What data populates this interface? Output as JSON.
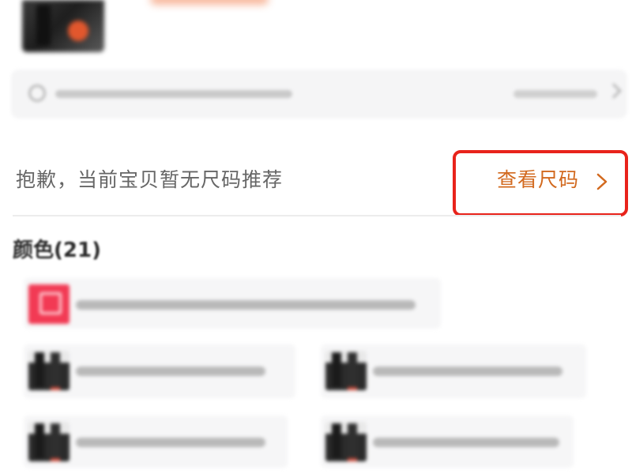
{
  "size_recommendation": {
    "message": "抱歉，当前宝贝暂无尺码推荐",
    "view_size_label": "查看尺码",
    "highlight_color": "#e8231b",
    "link_color": "#d2691e"
  },
  "colors": {
    "title": "颜色(21)"
  },
  "icons": {
    "chevron": "chevron-right-icon",
    "review": "chat-bubble-icon"
  }
}
